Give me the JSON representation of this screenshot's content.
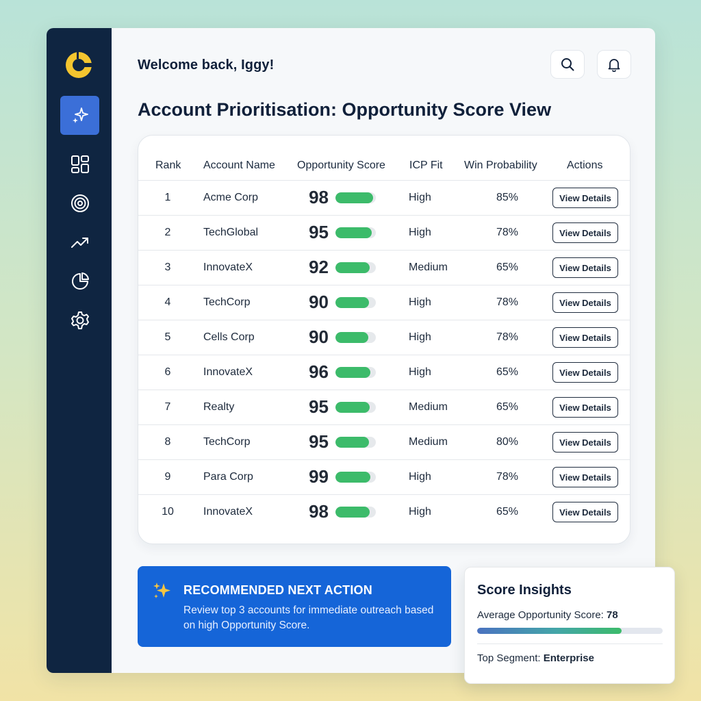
{
  "header": {
    "welcome": "Welcome back, Iggy!",
    "page_title": "Account Prioritisation: Opportunity Score View"
  },
  "sidebar": {
    "items": [
      {
        "icon": "sparkle-icon",
        "active": true
      },
      {
        "icon": "dashboard-grid-icon",
        "active": false
      },
      {
        "icon": "target-icon",
        "active": false
      },
      {
        "icon": "trending-up-icon",
        "active": false
      },
      {
        "icon": "pie-chart-icon",
        "active": false
      },
      {
        "icon": "gear-icon",
        "active": false
      }
    ]
  },
  "colors": {
    "sidebar": "#0f2541",
    "accent": "#3b6fd8",
    "score_bar": "#3cbb6a",
    "recommendation": "#1565d8"
  },
  "table": {
    "columns": [
      "Rank",
      "Account Name",
      "Opportunity Score",
      "ICP Fit",
      "Win Probability",
      "Actions"
    ],
    "action_label": "View Details",
    "rows": [
      {
        "rank": "1",
        "name": "Acme Corp",
        "score": 98,
        "icp": "High",
        "win": "85%"
      },
      {
        "rank": "2",
        "name": "TechGlobal",
        "score": 95,
        "icp": "High",
        "win": "78%"
      },
      {
        "rank": "3",
        "name": "InnovateX",
        "score": 92,
        "icp": "Medium",
        "win": "65%"
      },
      {
        "rank": "4",
        "name": "TechCorp",
        "score": 90,
        "icp": "High",
        "win": "78%"
      },
      {
        "rank": "5",
        "name": "Cells Corp",
        "score": 90,
        "icp": "High",
        "win": "78%"
      },
      {
        "rank": "6",
        "name": "InnovateX",
        "score": 96,
        "icp": "High",
        "win": "65%"
      },
      {
        "rank": "7",
        "name": "Realty",
        "score": 95,
        "icp": "Medium",
        "win": "65%"
      },
      {
        "rank": "8",
        "name": "TechCorp",
        "score": 95,
        "icp": "Medium",
        "win": "80%"
      },
      {
        "rank": "9",
        "name": "Para Corp",
        "score": 99,
        "icp": "High",
        "win": "78%"
      },
      {
        "rank": "10",
        "name": "InnovateX",
        "score": 98,
        "icp": "High",
        "win": "65%"
      }
    ]
  },
  "recommendation": {
    "title": "RECOMMENDED NEXT ACTION",
    "text": "Review top 3 accounts for immediate outreach based on high Opportunity Score."
  },
  "insights": {
    "title": "Score Insights",
    "avg_label": "Average Opportunity Score: ",
    "avg_value": "78",
    "avg_fill": 0.78,
    "segment_label": "Top Segment: ",
    "segment_value": "Enterprise"
  }
}
